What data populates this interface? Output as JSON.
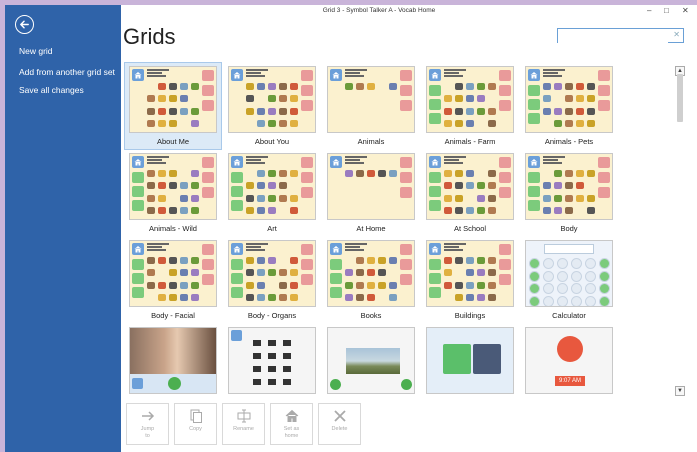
{
  "window": {
    "title": "Grid 3 - Symbol Talker A - Vocab Home",
    "controls": {
      "minimize": "–",
      "maximize": "□",
      "close": "✕"
    }
  },
  "sidebar": {
    "back_icon": "back-arrow-icon",
    "items": [
      {
        "label": "New grid"
      },
      {
        "label": "Add from another grid set"
      },
      {
        "label": "Save all changes"
      }
    ]
  },
  "main": {
    "title": "Grids",
    "search": {
      "value": "",
      "placeholder": "",
      "clear_icon": "✕"
    }
  },
  "grids": [
    {
      "label": "About Me",
      "selected": true,
      "style": "symbols"
    },
    {
      "label": "About You",
      "selected": false,
      "style": "symbols"
    },
    {
      "label": "Animals",
      "selected": false,
      "style": "symbols"
    },
    {
      "label": "Animals - Farm",
      "selected": false,
      "style": "symbols"
    },
    {
      "label": "Animals - Pets",
      "selected": false,
      "style": "symbols"
    },
    {
      "label": "Animals - Wild",
      "selected": false,
      "style": "symbols"
    },
    {
      "label": "Art",
      "selected": false,
      "style": "symbols"
    },
    {
      "label": "At Home",
      "selected": false,
      "style": "symbols"
    },
    {
      "label": "At School",
      "selected": false,
      "style": "symbols"
    },
    {
      "label": "Body",
      "selected": false,
      "style": "symbols"
    },
    {
      "label": "Body - Facial",
      "selected": false,
      "style": "symbols"
    },
    {
      "label": "Body - Organs",
      "selected": false,
      "style": "symbols"
    },
    {
      "label": "Books",
      "selected": false,
      "style": "symbols"
    },
    {
      "label": "Buildings",
      "selected": false,
      "style": "symbols"
    },
    {
      "label": "Calculator",
      "selected": false,
      "style": "calculator"
    },
    {
      "label": "",
      "selected": false,
      "style": "video"
    },
    {
      "label": "",
      "selected": false,
      "style": "list"
    },
    {
      "label": "",
      "selected": false,
      "style": "photo"
    },
    {
      "label": "",
      "selected": false,
      "style": "camera"
    },
    {
      "label": "",
      "selected": false,
      "style": "clock",
      "clock_time": "9:07 AM"
    }
  ],
  "toolbar": {
    "buttons": [
      {
        "label": "Jump\nto",
        "icon": "arrow-right-icon",
        "enabled": false
      },
      {
        "label": "Copy",
        "icon": "copy-icon",
        "enabled": false
      },
      {
        "label": "Rename",
        "icon": "rename-icon",
        "enabled": false
      },
      {
        "label": "Set as\nhome",
        "icon": "home-icon",
        "enabled": false
      },
      {
        "label": "Delete",
        "icon": "delete-icon",
        "enabled": false
      }
    ]
  },
  "colors": {
    "sidebar": "#2f63a9",
    "selected_tile": "#dceaf7",
    "tile_yellow": "#fbf1cf",
    "home_blue": "#6b9fd9",
    "side_pink": "#e99a9a",
    "side_green": "#7ccb7c"
  }
}
